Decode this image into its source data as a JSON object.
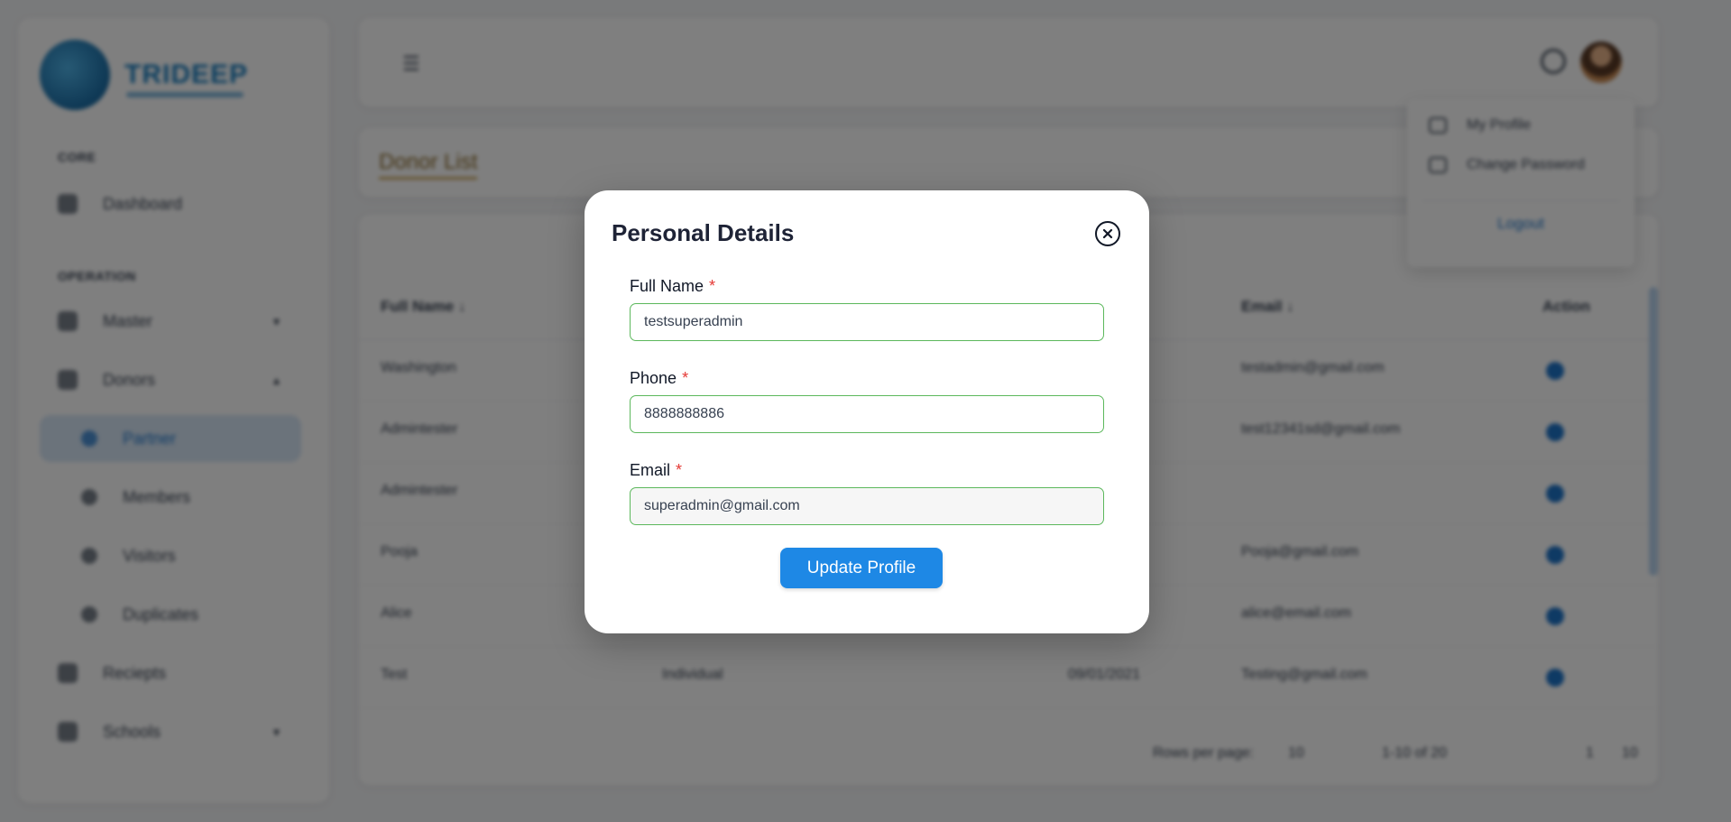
{
  "app": {
    "logo_text": "TRIDEEP",
    "sections": [
      "CORE",
      "OPERATION"
    ],
    "sidebar_items": [
      {
        "label": "Dashboard",
        "caret": ""
      },
      {
        "label": "Master",
        "caret": "▾"
      },
      {
        "label": "Donors",
        "caret": "▴"
      },
      {
        "label": "Partner",
        "caret": ""
      },
      {
        "label": "Members",
        "caret": ""
      },
      {
        "label": "Visitors",
        "caret": ""
      },
      {
        "label": "Duplicates",
        "caret": ""
      },
      {
        "label": "Reciepts",
        "caret": ""
      },
      {
        "label": "Schools",
        "caret": "▾"
      }
    ],
    "menu_icon": "menu-icon",
    "profile_menu": {
      "items": [
        "My Profile",
        "Change Password"
      ],
      "logout": "Logout"
    },
    "breadcrumb": "Donor List",
    "table": {
      "headers": [
        "Full Name ↓",
        "Email ↓",
        "Action"
      ],
      "rows": [
        {
          "name": "Washington",
          "type": "",
          "date": "",
          "email": "testadmin@gmail.com"
        },
        {
          "name": "Admintester",
          "type": "",
          "date": "",
          "email": "test12341sd@gmail.com"
        },
        {
          "name": "Admintester",
          "type": "",
          "date": "",
          "email": ""
        },
        {
          "name": "Pooja",
          "type": "",
          "date": "",
          "email": "Pooja@gmail.com"
        },
        {
          "name": "Alice",
          "type": "",
          "date": "",
          "email": "alice@email.com"
        },
        {
          "name": "Test",
          "type": "Individual",
          "date": "09/01/2021",
          "email": "Testing@gmail.com"
        }
      ],
      "pager": {
        "rows_label": "Rows per page:",
        "rows_value": "10",
        "range": "1-10 of 20",
        "page": "1",
        "total": "10"
      }
    }
  },
  "modal": {
    "title": "Personal Details",
    "fields": {
      "full_name": {
        "label": "Full Name",
        "value": "testsuperadmin",
        "required": "*"
      },
      "phone": {
        "label": "Phone",
        "value": "8888888886",
        "required": "*"
      },
      "email": {
        "label": "Email",
        "value": "superadmin@gmail.com",
        "required": "*"
      }
    },
    "submit_label": "Update Profile"
  }
}
